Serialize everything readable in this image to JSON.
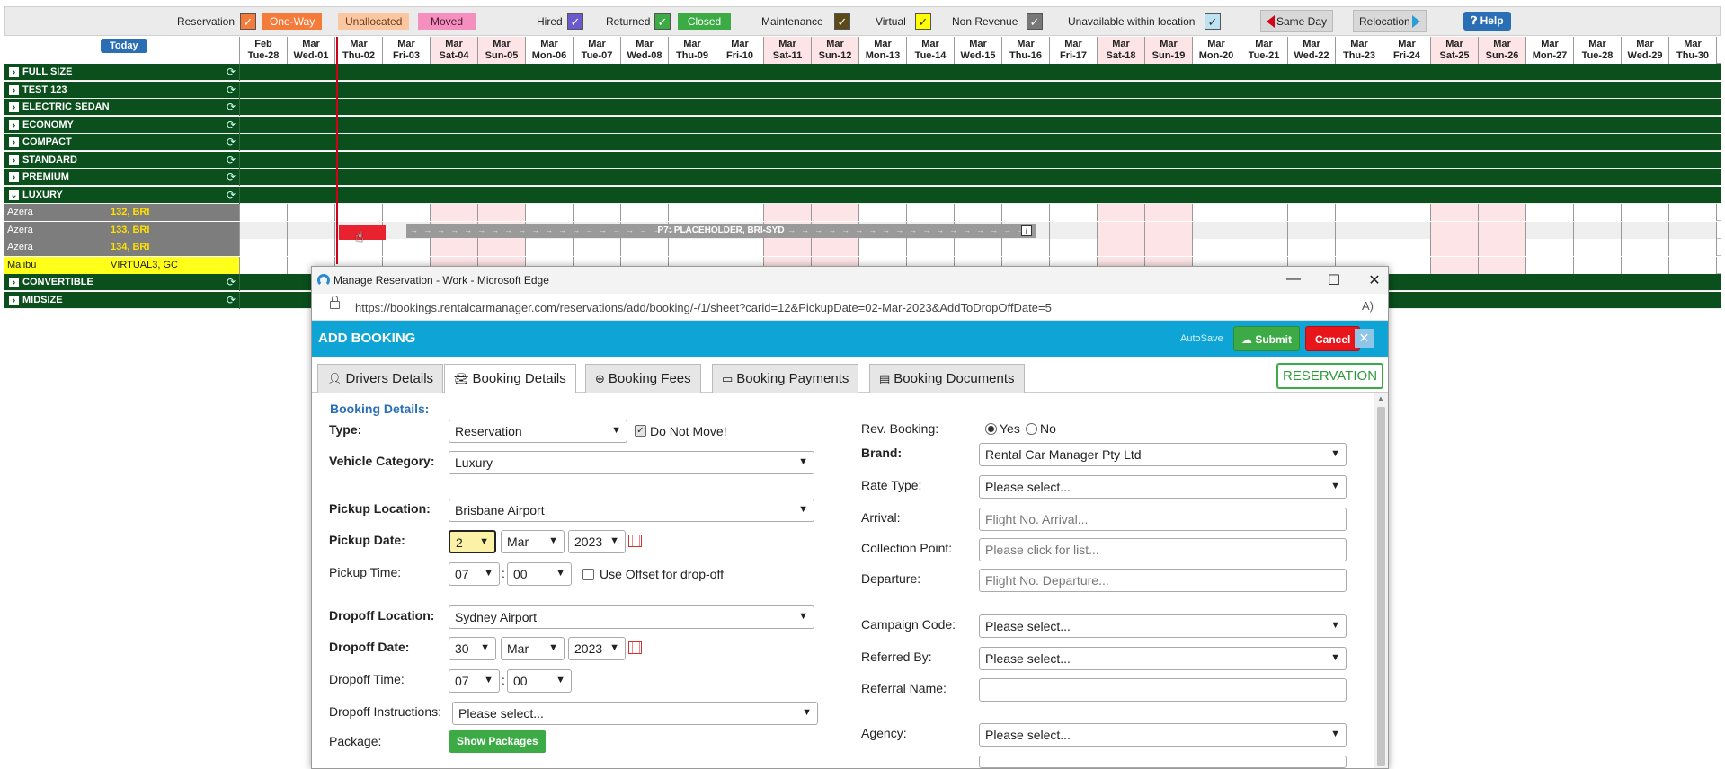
{
  "legend": {
    "reservation": "Reservation",
    "one_way": "One-Way",
    "unallocated": "Unallocated",
    "moved": "Moved",
    "hired": "Hired",
    "returned": "Returned",
    "closed": "Closed",
    "maintenance": "Maintenance",
    "virtual": "Virtual",
    "non_revenue": "Non Revenue",
    "unavailable": "Unavailable within location",
    "same_day": "Same Day",
    "relocation": "Relocation",
    "help": "Help",
    "colors": {
      "reservation": "#f47b3a",
      "one_way": "#f88f4d",
      "unallocated": "#fbc7a1",
      "moved": "#f48fbf",
      "hired": "#6a5acd",
      "returned": "#3cab45",
      "closed": "#3cab45",
      "maintenance": "#5b4a18",
      "virtual": "#ffff00",
      "non_revenue": "#777777",
      "unavailable": "#bde3f2"
    }
  },
  "grid": {
    "today_label": "Today",
    "dates": [
      {
        "m": "Feb",
        "d": "Tue-28",
        "wk": false
      },
      {
        "m": "Mar",
        "d": "Wed-01",
        "wk": false
      },
      {
        "m": "Mar",
        "d": "Thu-02",
        "wk": false
      },
      {
        "m": "Mar",
        "d": "Fri-03",
        "wk": false
      },
      {
        "m": "Mar",
        "d": "Sat-04",
        "wk": true
      },
      {
        "m": "Mar",
        "d": "Sun-05",
        "wk": true
      },
      {
        "m": "Mar",
        "d": "Mon-06",
        "wk": false
      },
      {
        "m": "Mar",
        "d": "Tue-07",
        "wk": false
      },
      {
        "m": "Mar",
        "d": "Wed-08",
        "wk": false
      },
      {
        "m": "Mar",
        "d": "Thu-09",
        "wk": false
      },
      {
        "m": "Mar",
        "d": "Fri-10",
        "wk": false
      },
      {
        "m": "Mar",
        "d": "Sat-11",
        "wk": true
      },
      {
        "m": "Mar",
        "d": "Sun-12",
        "wk": true
      },
      {
        "m": "Mar",
        "d": "Mon-13",
        "wk": false
      },
      {
        "m": "Mar",
        "d": "Tue-14",
        "wk": false
      },
      {
        "m": "Mar",
        "d": "Wed-15",
        "wk": false
      },
      {
        "m": "Mar",
        "d": "Thu-16",
        "wk": false
      },
      {
        "m": "Mar",
        "d": "Fri-17",
        "wk": false
      },
      {
        "m": "Mar",
        "d": "Sat-18",
        "wk": true
      },
      {
        "m": "Mar",
        "d": "Sun-19",
        "wk": true
      },
      {
        "m": "Mar",
        "d": "Mon-20",
        "wk": false
      },
      {
        "m": "Mar",
        "d": "Tue-21",
        "wk": false
      },
      {
        "m": "Mar",
        "d": "Wed-22",
        "wk": false
      },
      {
        "m": "Mar",
        "d": "Thu-23",
        "wk": false
      },
      {
        "m": "Mar",
        "d": "Fri-24",
        "wk": false
      },
      {
        "m": "Mar",
        "d": "Sat-25",
        "wk": true
      },
      {
        "m": "Mar",
        "d": "Sun-26",
        "wk": true
      },
      {
        "m": "Mar",
        "d": "Mon-27",
        "wk": false
      },
      {
        "m": "Mar",
        "d": "Tue-28",
        "wk": false
      },
      {
        "m": "Mar",
        "d": "Wed-29",
        "wk": false
      },
      {
        "m": "Mar",
        "d": "Thu-30",
        "wk": false
      }
    ],
    "categories_top": [
      "FULL SIZE",
      "TEST 123",
      "ELECTRIC SEDAN",
      "ECONOMY",
      "COMPACT",
      "STANDARD",
      "PREMIUM"
    ],
    "expanded_category": "LUXURY",
    "vehicles": [
      {
        "model": "Azera",
        "reg": "132, BRI",
        "yellow": false
      },
      {
        "model": "Azera",
        "reg": "133, BRI",
        "yellow": false
      },
      {
        "model": "Azera",
        "reg": "134, BRI",
        "yellow": false
      },
      {
        "model": "Malibu",
        "reg": "VIRTUAL3, GC",
        "yellow": true
      }
    ],
    "categories_bottom": [
      "CONVERTIBLE",
      "MIDSIZE"
    ],
    "booking_bar_label": "P7: PLACEHOLDER, BRI-SYD"
  },
  "window": {
    "title": "Manage Reservation - Work - Microsoft Edge",
    "url": "https://bookings.rentalcarmanager.com/reservations/add/booking/-/1/sheet?carid=12&PickupDate=02-Mar-2023&AddToDropOffDate=5"
  },
  "booking": {
    "title": "ADD BOOKING",
    "autosave": "AutoSave",
    "submit": "Submit",
    "cancel": "Cancel",
    "tabs": [
      "Drivers Details",
      "Booking Details",
      "Booking Fees",
      "Booking Payments",
      "Booking Documents"
    ],
    "status_button": "RESERVATION",
    "section_title": "Booking Details:",
    "left": {
      "type_label": "Type:",
      "type_value": "Reservation",
      "do_not_move": "Do Not Move!",
      "vehicle_category_label": "Vehicle Category:",
      "vehicle_category_value": "Luxury",
      "pickup_location_label": "Pickup Location:",
      "pickup_location_value": "Brisbane Airport",
      "pickup_date_label": "Pickup Date:",
      "pickup_day": "2",
      "pickup_month": "Mar",
      "pickup_year": "2023",
      "pickup_time_label": "Pickup Time:",
      "pickup_hour": "07",
      "pickup_min": "00",
      "use_offset": "Use Offset for drop-off",
      "dropoff_location_label": "Dropoff Location:",
      "dropoff_location_value": "Sydney Airport",
      "dropoff_date_label": "Dropoff Date:",
      "dropoff_day": "30",
      "dropoff_month": "Mar",
      "dropoff_year": "2023",
      "dropoff_time_label": "Dropoff Time:",
      "dropoff_hour": "07",
      "dropoff_min": "00",
      "dropoff_instructions_label": "Dropoff Instructions:",
      "dropoff_instructions_value": "Please select...",
      "package_label": "Package:",
      "show_packages": "Show Packages"
    },
    "right": {
      "rev_booking_label": "Rev. Booking:",
      "yes": "Yes",
      "no": "No",
      "brand_label": "Brand:",
      "brand_value": "Rental Car Manager Pty Ltd",
      "rate_type_label": "Rate Type:",
      "rate_type_value": "Please select...",
      "arrival_label": "Arrival:",
      "arrival_placeholder": "Flight No. Arrival...",
      "collection_label": "Collection Point:",
      "collection_placeholder": "Please click for list...",
      "departure_label": "Departure:",
      "departure_placeholder": "Flight No. Departure...",
      "campaign_label": "Campaign Code:",
      "campaign_value": "Please select...",
      "referred_label": "Referred By:",
      "referred_value": "Please select...",
      "referral_name_label": "Referral Name:",
      "agency_label": "Agency:",
      "agency_value": "Please select..."
    }
  }
}
